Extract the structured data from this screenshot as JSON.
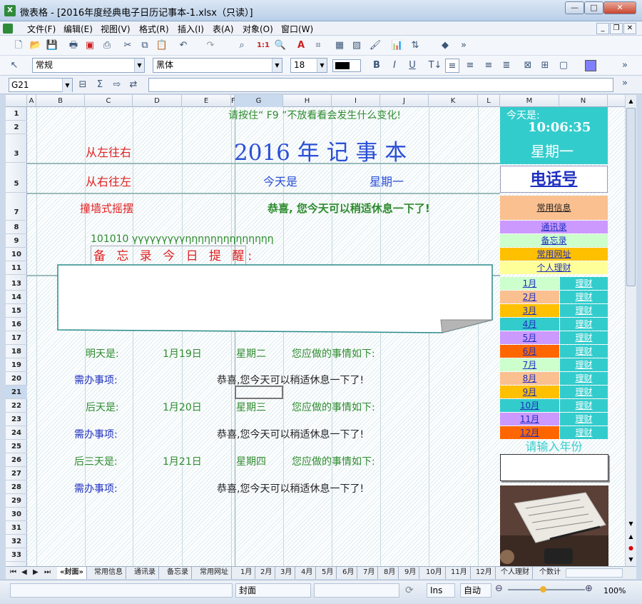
{
  "window": {
    "title": "微表格 - [2016年度经典电子日历记事本-1.xlsx（只读）]",
    "app_icon": "X",
    "min": "—",
    "max": "□",
    "close": "✕"
  },
  "menu": [
    "文件(F)",
    "编辑(E)",
    "视图(V)",
    "格式(R)",
    "插入(I)",
    "表(A)",
    "对象(O)",
    "窗口(W)"
  ],
  "toolbar2": {
    "style": "常规",
    "font": "黑体",
    "size": "18"
  },
  "formula": {
    "cell_ref": "G21",
    "value": ""
  },
  "columns": [
    "A",
    "B",
    "C",
    "D",
    "E",
    "F",
    "G",
    "H",
    "I",
    "J",
    "K",
    "L",
    "M",
    "N"
  ],
  "rows": [
    "1",
    "2",
    "3",
    "5",
    "7",
    "8",
    "9",
    "10",
    "11",
    "13",
    "14",
    "15",
    "16",
    "17",
    "18",
    "19",
    "20",
    "21",
    "22",
    "23",
    "24",
    "25",
    "26",
    "27",
    "28",
    "29",
    "30",
    "31",
    "32",
    "33"
  ],
  "sheet": {
    "hint": "请按住“ F9 ”不放看看会发生什么变化!",
    "title": "2016 年 记 事 本",
    "left_to_right": "从左往右",
    "right_to_left": "从右往左",
    "today_is": "今天是",
    "weekday": "星期一",
    "collide": "撞墙式摇摆",
    "congrats_bold": "恭喜, 您今天可以稍适休息一下了!",
    "ticker": "101010 γγγγγγγγγηηηηηηηηηηηηηη",
    "memo_title": "备 忘 录 今 日 提 醒:",
    "tomorrow_label": "明天是:",
    "tomorrow_date": "1月19日",
    "tomorrow_weekday": "星期二",
    "todo_intro": "您应做的事情如下:",
    "todo_label": "需办事项:",
    "congrats": "恭喜,您今天可以稍适休息一下了!",
    "day_after_label": "后天是:",
    "day_after_date": "1月20日",
    "day_after_weekday": "星期三",
    "third_day_label": "后三天是:",
    "third_day_date": "1月21日",
    "third_day_weekday": "星期四"
  },
  "side": {
    "today_label": "今天是:",
    "time": "10:06:35",
    "weekday": "星期一",
    "phone": "电话号",
    "common_info": "常用信息",
    "contacts": "通讯录",
    "memo": "备忘录",
    "websites": "常用网址",
    "finance": "个人理财",
    "months": [
      "1月",
      "2月",
      "3月",
      "4月",
      "5月",
      "6月",
      "7月",
      "8月",
      "9月",
      "10月",
      "11月",
      "12月"
    ],
    "finance_link": "理财",
    "year_prompt": "请输入年份"
  },
  "sheet_tabs": [
    "«封面»",
    "常用信息",
    "通讯录",
    "备忘录",
    "常用网址",
    "1月",
    "2月",
    "3月",
    "4月",
    "5月",
    "6月",
    "7月",
    "8月",
    "9月",
    "10月",
    "11月",
    "12月",
    "个人理财",
    "个数计"
  ],
  "status": {
    "sheet": "封面",
    "mode": "Ins",
    "calc": "自动",
    "zoom": "100%"
  },
  "colors": {
    "green": "#2e8b2e",
    "red": "#e02020",
    "blue": "#2b4fd6",
    "navy": "#1e2fc0",
    "teal": "#33cccc",
    "peach": "#fac090",
    "lavender": "#cc99ff",
    "mint": "#ccffcc",
    "gold": "#ffc000",
    "yellow": "#ffff99",
    "orange": "#ff6600"
  }
}
